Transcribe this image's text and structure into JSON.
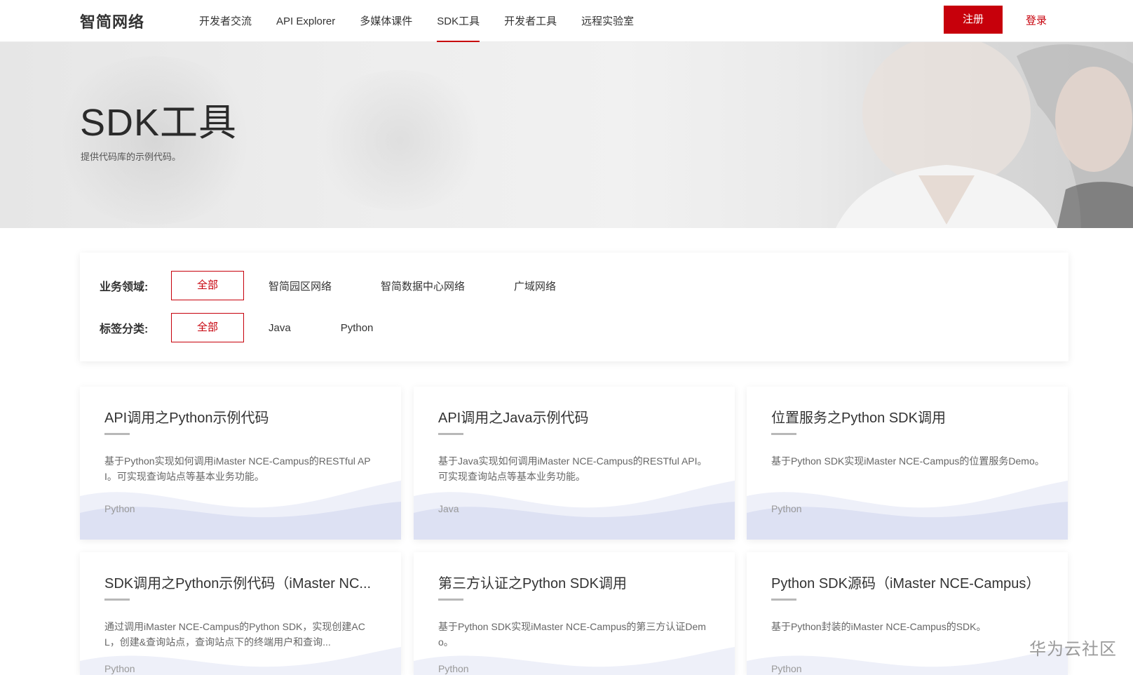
{
  "header": {
    "logo": "智简网络",
    "nav": [
      {
        "label": "开发者交流"
      },
      {
        "label": "API Explorer"
      },
      {
        "label": "多媒体课件"
      },
      {
        "label": "SDK工具",
        "active": true
      },
      {
        "label": "开发者工具"
      },
      {
        "label": "远程实验室"
      }
    ],
    "register_label": "注册",
    "login_label": "登录"
  },
  "hero": {
    "title": "SDK工具",
    "subtitle": "提供代码库的示例代码。"
  },
  "filters": {
    "domain_label": "业务领域:",
    "domain_options": [
      "全部",
      "智简园区网络",
      "智简数据中心网络",
      "广域网络"
    ],
    "tag_label": "标签分类:",
    "tag_options": [
      "全部",
      "Java",
      "Python"
    ]
  },
  "cards": [
    {
      "title": "API调用之Python示例代码",
      "desc": "基于Python实现如何调用iMaster NCE-Campus的RESTful API。可实现查询站点等基本业务功能。",
      "tag": "Python"
    },
    {
      "title": "API调用之Java示例代码",
      "desc": "基于Java实现如何调用iMaster NCE-Campus的RESTful API。可实现查询站点等基本业务功能。",
      "tag": "Java"
    },
    {
      "title": "位置服务之Python SDK调用",
      "desc": "基于Python SDK实现iMaster NCE-Campus的位置服务Demo。",
      "tag": "Python"
    },
    {
      "title": "SDK调用之Python示例代码（iMaster NC...",
      "desc": "通过调用iMaster NCE-Campus的Python SDK，实现创建ACL，创建&查询站点，查询站点下的终端用户和查询...",
      "tag": "Python"
    },
    {
      "title": "第三方认证之Python SDK调用",
      "desc": "基于Python SDK实现iMaster NCE-Campus的第三方认证Demo。",
      "tag": "Python"
    },
    {
      "title": "Python SDK源码（iMaster NCE-Campus）",
      "desc": "基于Python封装的iMaster NCE-Campus的SDK。",
      "tag": "Python"
    }
  ],
  "watermark": "华为云社区",
  "colors": {
    "accent": "#c7000b",
    "wave": "#dde1f3"
  }
}
